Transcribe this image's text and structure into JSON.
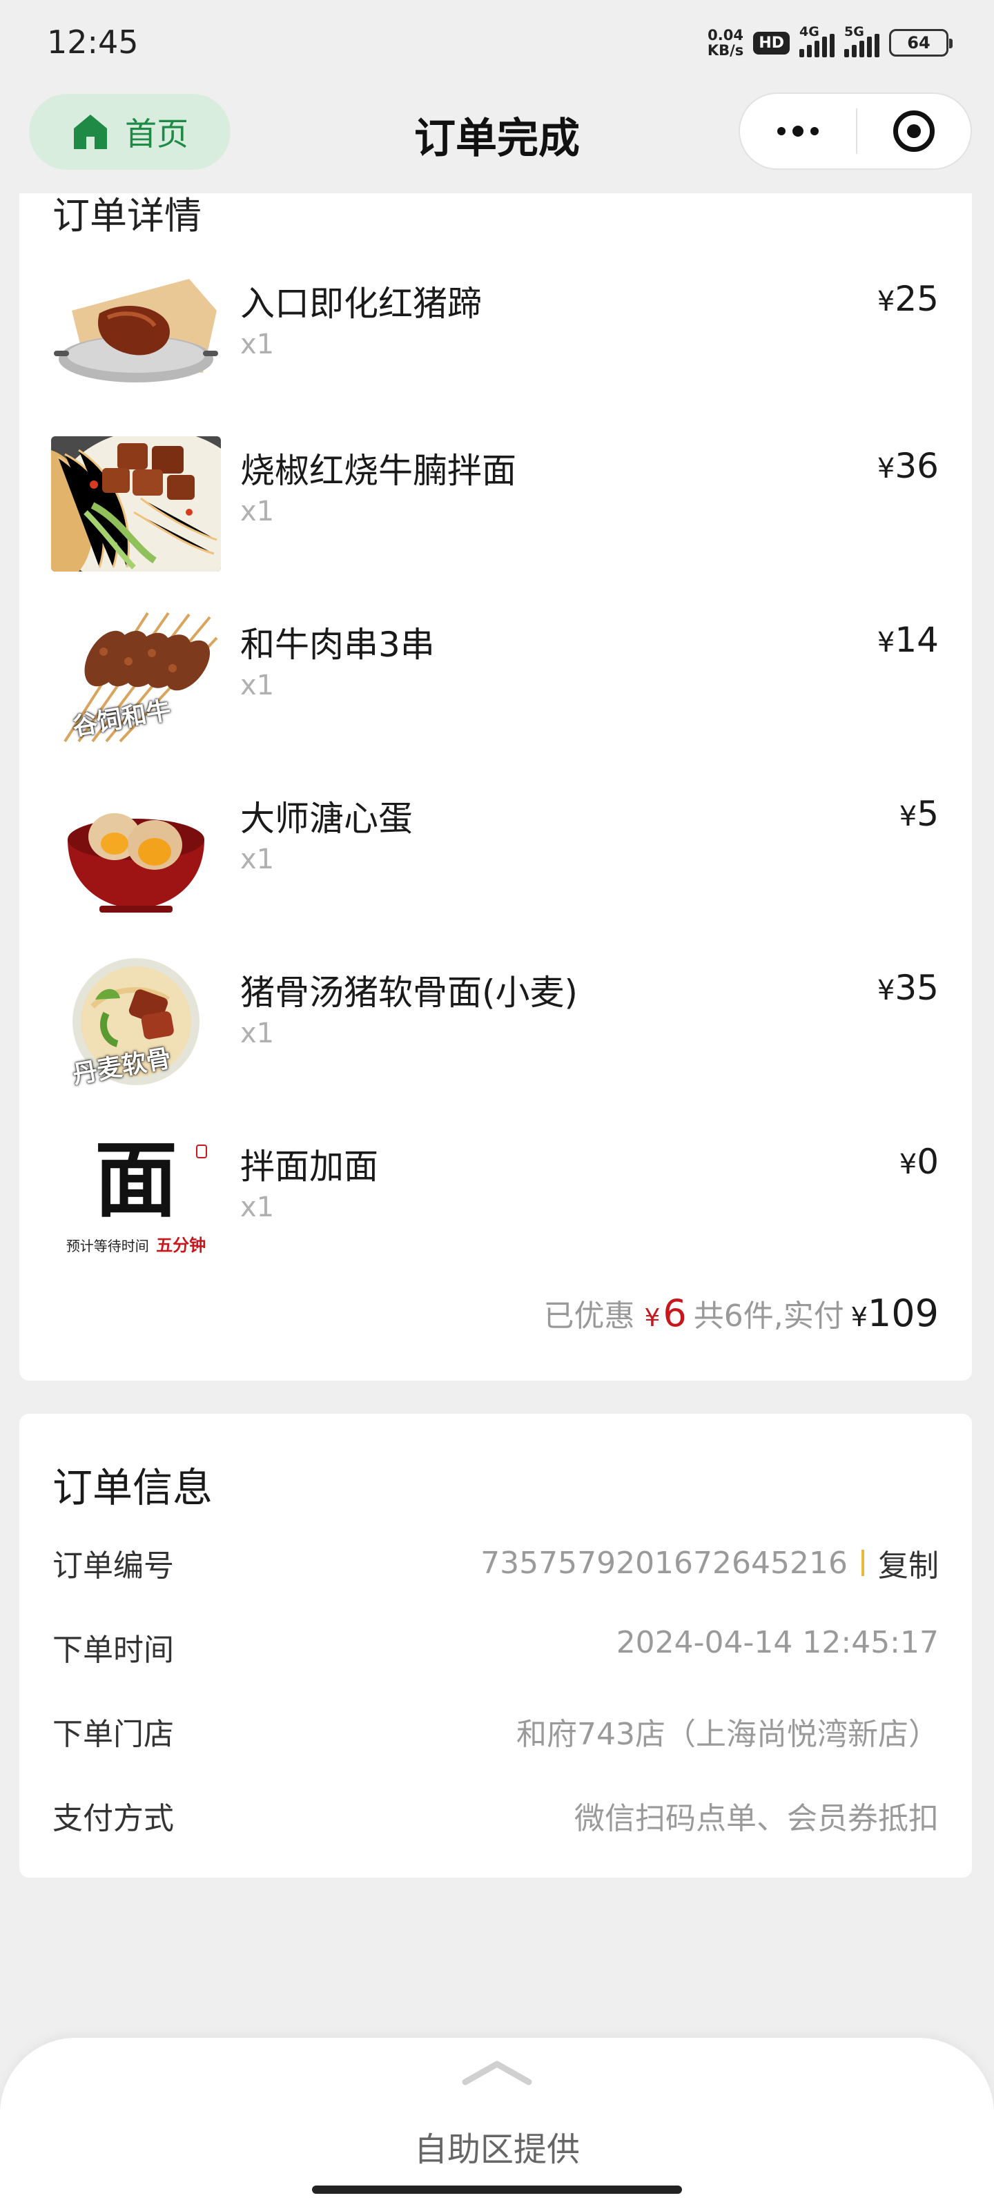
{
  "status_bar": {
    "time": "12:45",
    "net_speed_value": "0.04",
    "net_speed_unit": "KB/s",
    "hd_badge": "HD",
    "signal1_label": "4G",
    "signal2_label": "5G",
    "battery": "64"
  },
  "nav": {
    "home_label": "首页",
    "title": "订单完成",
    "more_icon": "more-dots-icon",
    "close_icon": "target-circle-icon"
  },
  "order_details": {
    "title": "订单详情",
    "items": [
      {
        "name": "入口即化红猪蹄",
        "qty": "x1",
        "price": "25"
      },
      {
        "name": "烧椒红烧牛腩拌面",
        "qty": "x1",
        "price": "36"
      },
      {
        "name": "和牛肉串3串",
        "qty": "x1",
        "price": "14",
        "thumb_text": "谷饲和牛"
      },
      {
        "name": "大师溏心蛋",
        "qty": "x1",
        "price": "5"
      },
      {
        "name": "猪骨汤猪软骨面(小麦)",
        "qty": "x1",
        "price": "35",
        "thumb_text": "丹麦软骨"
      },
      {
        "name": "拌面加面",
        "qty": "x1",
        "price": "0",
        "thumb_text_main": "面",
        "thumb_text_sub": "预计等待时间",
        "thumb_text_accent": "五分钟"
      }
    ],
    "currency_symbol": "¥",
    "summary": {
      "discount_label": "已优惠",
      "discount_value": "6",
      "count_label": "共6件,实付",
      "total_value": "109"
    }
  },
  "order_info": {
    "title": "订单信息",
    "rows": [
      {
        "label": "订单编号",
        "value": "7357579201672645216",
        "action": "复制"
      },
      {
        "label": "下单时间",
        "value": "2024-04-14 12:45:17"
      },
      {
        "label": "下单门店",
        "value": "和府743店（上海尚悦湾新店）"
      },
      {
        "label": "支付方式",
        "value": "微信扫码点单、会员券抵扣"
      }
    ]
  },
  "bottom_sheet": {
    "label": "自助区提供"
  },
  "colors": {
    "accent_green": "#1f8a46",
    "discount_red": "#c8161d",
    "background": "#efefef"
  }
}
